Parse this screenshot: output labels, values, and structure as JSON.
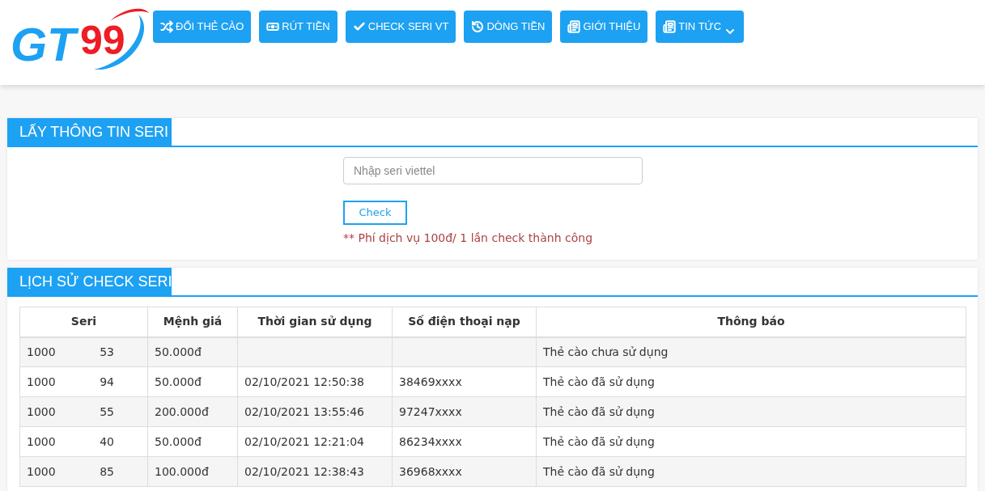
{
  "logo": {
    "letters": "GT",
    "digits": "99"
  },
  "nav": [
    {
      "label": "ĐỔI THẺ CÀO",
      "kind": "shuffle"
    },
    {
      "label": "RÚT TIỀN",
      "kind": "money"
    },
    {
      "label": "CHECK SERI VT",
      "kind": "check"
    },
    {
      "label": "DÒNG TIỀN",
      "kind": "history"
    },
    {
      "label": "GIỚI THIỆU",
      "kind": "news"
    },
    {
      "label": "TIN TỨC",
      "kind": "news",
      "dropdown": true
    }
  ],
  "check_panel": {
    "title": "LẤY THÔNG TIN SERI",
    "input": {
      "placeholder": "Nhập seri viettel"
    },
    "button": "Check",
    "note": "** Phí dịch vụ 100đ/ 1 lần check thành công"
  },
  "history_panel": {
    "title": "LỊCH SỬ CHECK SERI",
    "table": {
      "columns": [
        "Seri",
        "Mệnh giá",
        "Thời gian sử dụng",
        "Số điện thoại nạp",
        "Thông báo"
      ],
      "rows": [
        {
          "seri_start": "1000",
          "seri_end": "53",
          "value": "50.000đ",
          "time": "",
          "phone": "",
          "message": "Thẻ cào chưa sử dụng"
        },
        {
          "seri_start": "1000",
          "seri_end": "94",
          "value": "50.000đ",
          "time": "02/10/2021 12:50:38",
          "phone": "38469xxxx",
          "message": "Thẻ cào đã sử dụng"
        },
        {
          "seri_start": "1000",
          "seri_end": "55",
          "value": "200.000đ",
          "time": "02/10/2021 13:55:46",
          "phone": "97247xxxx",
          "message": "Thẻ cào đã sử dụng"
        },
        {
          "seri_start": "1000",
          "seri_end": "40",
          "value": "50.000đ",
          "time": "02/10/2021 12:21:04",
          "phone": "86234xxxx",
          "message": "Thẻ cào đã sử dụng"
        },
        {
          "seri_start": "1000",
          "seri_end": "85",
          "value": "100.000đ",
          "time": "02/10/2021 12:38:43",
          "phone": "36968xxxx",
          "message": "Thẻ cào đã sử dụng"
        }
      ]
    }
  }
}
